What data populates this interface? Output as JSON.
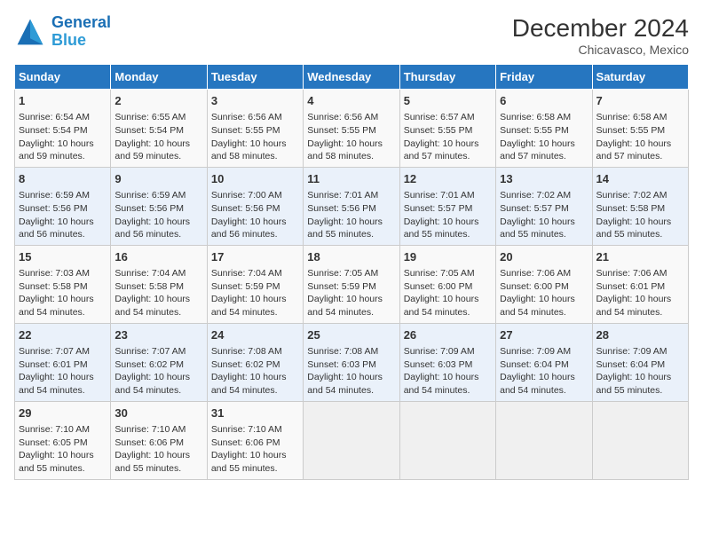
{
  "header": {
    "logo_line1": "General",
    "logo_line2": "Blue",
    "title": "December 2024",
    "subtitle": "Chicavasco, Mexico"
  },
  "calendar": {
    "days_of_week": [
      "Sunday",
      "Monday",
      "Tuesday",
      "Wednesday",
      "Thursday",
      "Friday",
      "Saturday"
    ],
    "weeks": [
      [
        null,
        {
          "day": 2,
          "sunrise": "6:55 AM",
          "sunset": "5:54 PM",
          "daylight": "10 hours and 59 minutes."
        },
        {
          "day": 3,
          "sunrise": "6:56 AM",
          "sunset": "5:55 PM",
          "daylight": "10 hours and 58 minutes."
        },
        {
          "day": 4,
          "sunrise": "6:56 AM",
          "sunset": "5:55 PM",
          "daylight": "10 hours and 58 minutes."
        },
        {
          "day": 5,
          "sunrise": "6:57 AM",
          "sunset": "5:55 PM",
          "daylight": "10 hours and 57 minutes."
        },
        {
          "day": 6,
          "sunrise": "6:58 AM",
          "sunset": "5:55 PM",
          "daylight": "10 hours and 57 minutes."
        },
        {
          "day": 7,
          "sunrise": "6:58 AM",
          "sunset": "5:55 PM",
          "daylight": "10 hours and 57 minutes."
        }
      ],
      [
        {
          "day": 1,
          "sunrise": "6:54 AM",
          "sunset": "5:54 PM",
          "daylight": "10 hours and 59 minutes."
        },
        null,
        null,
        null,
        null,
        null,
        null
      ],
      [
        {
          "day": 8,
          "sunrise": "6:59 AM",
          "sunset": "5:56 PM",
          "daylight": "10 hours and 56 minutes."
        },
        {
          "day": 9,
          "sunrise": "6:59 AM",
          "sunset": "5:56 PM",
          "daylight": "10 hours and 56 minutes."
        },
        {
          "day": 10,
          "sunrise": "7:00 AM",
          "sunset": "5:56 PM",
          "daylight": "10 hours and 56 minutes."
        },
        {
          "day": 11,
          "sunrise": "7:01 AM",
          "sunset": "5:56 PM",
          "daylight": "10 hours and 55 minutes."
        },
        {
          "day": 12,
          "sunrise": "7:01 AM",
          "sunset": "5:57 PM",
          "daylight": "10 hours and 55 minutes."
        },
        {
          "day": 13,
          "sunrise": "7:02 AM",
          "sunset": "5:57 PM",
          "daylight": "10 hours and 55 minutes."
        },
        {
          "day": 14,
          "sunrise": "7:02 AM",
          "sunset": "5:58 PM",
          "daylight": "10 hours and 55 minutes."
        }
      ],
      [
        {
          "day": 15,
          "sunrise": "7:03 AM",
          "sunset": "5:58 PM",
          "daylight": "10 hours and 54 minutes."
        },
        {
          "day": 16,
          "sunrise": "7:04 AM",
          "sunset": "5:58 PM",
          "daylight": "10 hours and 54 minutes."
        },
        {
          "day": 17,
          "sunrise": "7:04 AM",
          "sunset": "5:59 PM",
          "daylight": "10 hours and 54 minutes."
        },
        {
          "day": 18,
          "sunrise": "7:05 AM",
          "sunset": "5:59 PM",
          "daylight": "10 hours and 54 minutes."
        },
        {
          "day": 19,
          "sunrise": "7:05 AM",
          "sunset": "6:00 PM",
          "daylight": "10 hours and 54 minutes."
        },
        {
          "day": 20,
          "sunrise": "7:06 AM",
          "sunset": "6:00 PM",
          "daylight": "10 hours and 54 minutes."
        },
        {
          "day": 21,
          "sunrise": "7:06 AM",
          "sunset": "6:01 PM",
          "daylight": "10 hours and 54 minutes."
        }
      ],
      [
        {
          "day": 22,
          "sunrise": "7:07 AM",
          "sunset": "6:01 PM",
          "daylight": "10 hours and 54 minutes."
        },
        {
          "day": 23,
          "sunrise": "7:07 AM",
          "sunset": "6:02 PM",
          "daylight": "10 hours and 54 minutes."
        },
        {
          "day": 24,
          "sunrise": "7:08 AM",
          "sunset": "6:02 PM",
          "daylight": "10 hours and 54 minutes."
        },
        {
          "day": 25,
          "sunrise": "7:08 AM",
          "sunset": "6:03 PM",
          "daylight": "10 hours and 54 minutes."
        },
        {
          "day": 26,
          "sunrise": "7:09 AM",
          "sunset": "6:03 PM",
          "daylight": "10 hours and 54 minutes."
        },
        {
          "day": 27,
          "sunrise": "7:09 AM",
          "sunset": "6:04 PM",
          "daylight": "10 hours and 54 minutes."
        },
        {
          "day": 28,
          "sunrise": "7:09 AM",
          "sunset": "6:04 PM",
          "daylight": "10 hours and 55 minutes."
        }
      ],
      [
        {
          "day": 29,
          "sunrise": "7:10 AM",
          "sunset": "6:05 PM",
          "daylight": "10 hours and 55 minutes."
        },
        {
          "day": 30,
          "sunrise": "7:10 AM",
          "sunset": "6:06 PM",
          "daylight": "10 hours and 55 minutes."
        },
        {
          "day": 31,
          "sunrise": "7:10 AM",
          "sunset": "6:06 PM",
          "daylight": "10 hours and 55 minutes."
        },
        null,
        null,
        null,
        null
      ]
    ]
  }
}
